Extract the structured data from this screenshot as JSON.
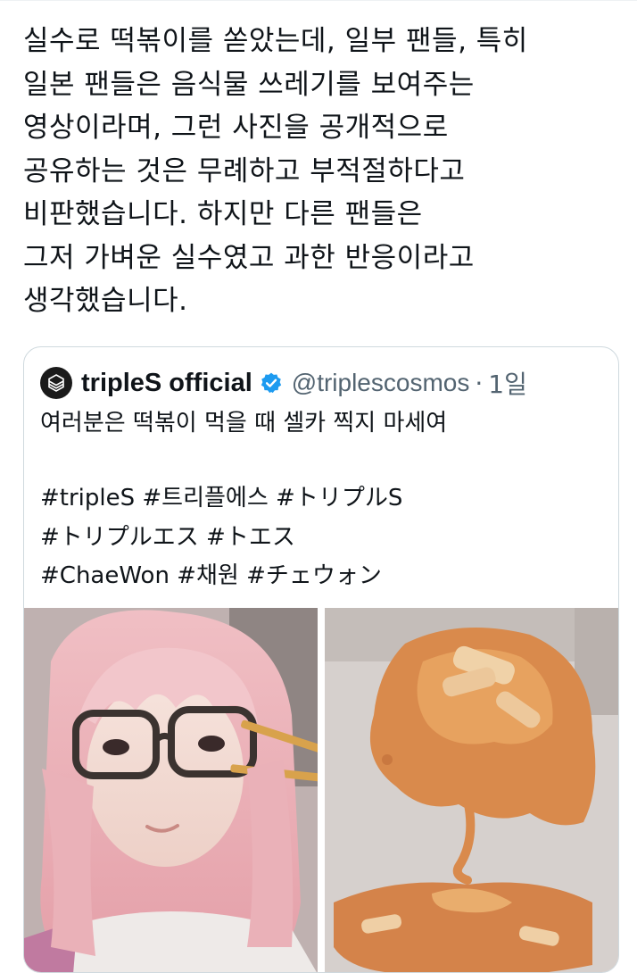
{
  "post": {
    "text": "실수로 떡볶이를 쏟았는데, 일부 팬들, 특히\n일본 팬들은 음식물 쓰레기를 보여주는\n영상이라며, 그런 사진을 공개적으로\n공유하는 것은 무례하고 부적절하다고\n비판했습니다. 하지만 다른 팬들은\n그저 가벼운 실수였고 과한 반응이라고\n생각했습니다."
  },
  "quote": {
    "author_name": "tripleS official",
    "verified_icon": "verified-badge-icon",
    "handle": "@triplescosmos",
    "separator": "·",
    "time": "1일",
    "text": "여러분은 떡볶이 먹을 때 셀카 찍지 마세여",
    "hashtags": [
      "#tripleS #트리플에스 #トリプルS",
      "#トリプルエス #トエス",
      "#ChaeWon #채원 #チェウォン"
    ],
    "colors": {
      "verified": "#1d9bf0",
      "handle": "#536471",
      "border": "#cfd9de"
    },
    "images": [
      "selfie-photo",
      "spilled-tteokbokki-photo"
    ]
  }
}
